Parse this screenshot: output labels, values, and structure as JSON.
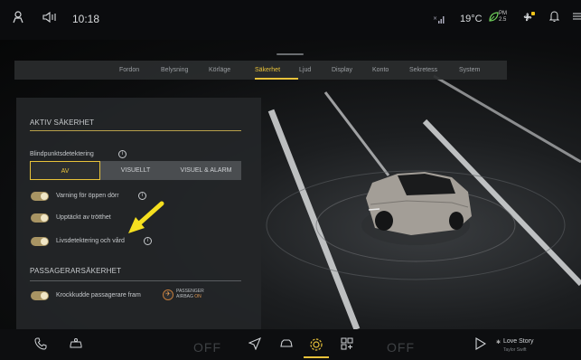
{
  "statusbar": {
    "clock": "10:18",
    "temperature": "19°C",
    "pm_label": "PM",
    "pm_value": "2.5",
    "icons": [
      "person-icon",
      "volume-icon",
      "signal-icon",
      "leaf-icon",
      "fan-icon",
      "bell-icon",
      "menu-icon"
    ]
  },
  "tabs": [
    {
      "label": "Fordon"
    },
    {
      "label": "Belysning"
    },
    {
      "label": "Körläge"
    },
    {
      "label": "Säkerhet",
      "active": true
    },
    {
      "label": "Ljud"
    },
    {
      "label": "Display"
    },
    {
      "label": "Konto"
    },
    {
      "label": "Sekretess"
    },
    {
      "label": "System"
    }
  ],
  "active_section": {
    "title": "AKTIV SÄKERHET",
    "blindspot_label": "Blindpunktsdetektering",
    "blindspot_options": [
      "AV",
      "VISUELLT",
      "VISUEL & ALARM"
    ],
    "blindspot_selected": "AV",
    "toggles": [
      {
        "label": "Varning för öppen dörr",
        "on": true
      },
      {
        "label": "Upptäckt av trötthet",
        "on": true
      },
      {
        "label": "Livsdetektering och vård",
        "on": true
      }
    ]
  },
  "passenger_section": {
    "title": "PASSAGERARSÄKERHET",
    "airbag_toggle_label": "Krockkudde passagerare fram",
    "airbag_on": true,
    "airbag_status_line1": "PASSENGER",
    "airbag_status_line2": "AIRBAG",
    "airbag_status_state": "ON"
  },
  "bottombar": {
    "left_off": "OFF",
    "right_off": "OFF",
    "song_title": "Love Story",
    "song_artist": "Taylor Swift",
    "icons": [
      "phone-icon",
      "car-fan-icon",
      "navigation-icon",
      "car-icon",
      "settings-icon",
      "apps-icon",
      "play-icon",
      "bluetooth-icon"
    ]
  },
  "colors": {
    "accent": "#e8c23a",
    "toggle_on": "#a89463",
    "airbag_warning": "#e29b55",
    "leaf_green": "#6fd05a"
  }
}
